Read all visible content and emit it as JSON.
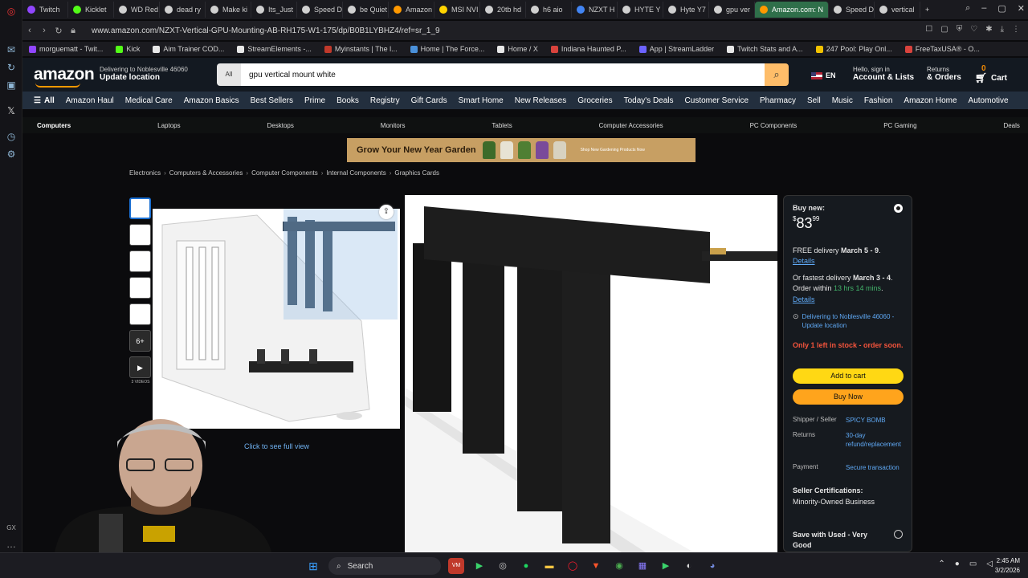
{
  "browser": {
    "tabs": [
      {
        "label": "Twitch",
        "color": "#9146ff"
      },
      {
        "label": "Kicklet",
        "color": "#53fc18"
      },
      {
        "label": "WD Red",
        "color": "#d0d0d0"
      },
      {
        "label": "dead ry",
        "color": "#d0d0d0"
      },
      {
        "label": "Make ki",
        "color": "#d0d0d0"
      },
      {
        "label": "Its_Just",
        "color": "#d0d0d0"
      },
      {
        "label": "Speed D",
        "color": "#d0d0d0"
      },
      {
        "label": "be Quiet",
        "color": "#d0d0d0"
      },
      {
        "label": "Amazon",
        "color": "#ff9900"
      },
      {
        "label": "MSI NVI",
        "color": "#ffd400"
      },
      {
        "label": "20tb hd",
        "color": "#d0d0d0"
      },
      {
        "label": "h6 aio",
        "color": "#d0d0d0"
      },
      {
        "label": "NZXT H",
        "color": "#4285f4"
      },
      {
        "label": "HYTE Y",
        "color": "#d0d0d0"
      },
      {
        "label": "Hyte Y7",
        "color": "#d0d0d0"
      },
      {
        "label": "gpu ver",
        "color": "#d0d0d0"
      },
      {
        "label": "Amazon.com: N",
        "color": "#ff9900",
        "active": true
      },
      {
        "label": "Speed D",
        "color": "#d0d0d0"
      },
      {
        "label": "vertical",
        "color": "#d0d0d0"
      }
    ],
    "new_tab": "+",
    "url": "www.amazon.com/NZXT-Vertical-GPU-Mounting-AB-RH175-W1-175/dp/B0B1LYBHZ4/ref=sr_1_9",
    "bookmarks": [
      {
        "label": "morguematt - Twit...",
        "color": "#9146ff"
      },
      {
        "label": "Kick",
        "color": "#53fc18"
      },
      {
        "label": "Aim Trainer COD...",
        "color": "#e8e8e8"
      },
      {
        "label": "StreamElements -...",
        "color": "#e8e8e8"
      },
      {
        "label": "Myinstants | The l...",
        "color": "#c0392b"
      },
      {
        "label": "Home | The Force...",
        "color": "#4a90d9"
      },
      {
        "label": "Home / X",
        "color": "#e8e8e8"
      },
      {
        "label": "Indiana Haunted P...",
        "color": "#d9433d"
      },
      {
        "label": "App | StreamLadder",
        "color": "#6c63ff"
      },
      {
        "label": "Twitch Stats and A...",
        "color": "#e8e8e8"
      },
      {
        "label": "247 Pool: Play Onl...",
        "color": "#f2c200"
      },
      {
        "label": "FreeTaxUSA® - O...",
        "color": "#d9433d"
      }
    ]
  },
  "amazon": {
    "logo": "amazon",
    "deliver_line1": "Delivering to Noblesville 46060",
    "deliver_line2": "Update location",
    "search_category": "All",
    "search_value": "gpu vertical mount white",
    "lang": "EN",
    "account_line1": "Hello, sign in",
    "account_line2": "Account & Lists",
    "returns_line1": "Returns",
    "returns_line2": "& Orders",
    "cart_count": "0",
    "cart_label": "Cart",
    "nav_all": "All",
    "nav": [
      "Amazon Haul",
      "Medical Care",
      "Amazon Basics",
      "Best Sellers",
      "Prime",
      "Books",
      "Registry",
      "Gift Cards",
      "Smart Home",
      "New Releases",
      "Groceries",
      "Today's Deals",
      "Customer Service",
      "Pharmacy",
      "Sell",
      "Music",
      "Fashion",
      "Amazon Home",
      "Automotive"
    ],
    "subnav": [
      "Computers",
      "Laptops",
      "Desktops",
      "Monitors",
      "Tablets",
      "Computer Accessories",
      "PC Components",
      "PC Gaming",
      "Deals"
    ],
    "banner_text": "Grow Your New Year Garden",
    "banner_shop": "Shop New Gardening Products Now",
    "breadcrumb": [
      "Electronics",
      "Computers & Accessories",
      "Computer Components",
      "Internal Components",
      "Graphics Cards"
    ],
    "thumb_more": "6+",
    "videos_label": "3 VIDEOS",
    "see_full_view": "Click to see full view"
  },
  "buybox": {
    "buy_new": "Buy new:",
    "price_dollar": "$",
    "price_whole": "83",
    "price_cents": "99",
    "free_delivery_prefix": "FREE delivery ",
    "free_delivery_date": "March 5 - 9",
    "free_delivery_suffix": ".",
    "details": "Details",
    "fastest_prefix": "Or fastest delivery ",
    "fastest_date": "March 3 - 4",
    "fastest_suffix": ".",
    "order_within_prefix": "Order within ",
    "order_within_time": "13 hrs 14 mins",
    "order_within_suffix": ".",
    "details2": "Details",
    "location": "Delivering to Noblesville 46060 - Update location",
    "stock": "Only 1 left in stock - order soon.",
    "add_to_cart": "Add to cart",
    "buy_now": "Buy Now",
    "shipper_label": "Shipper / Seller",
    "shipper_value": "SPICY BOMB",
    "returns_label": "Returns",
    "returns_value": "30-day refund/replacement",
    "payment_label": "Payment",
    "payment_value": "Secure transaction",
    "cert_title": "Seller Certifications:",
    "cert_value": "Minority-Owned Business",
    "used": "Save with Used - Very Good"
  },
  "taskbar": {
    "search": "Search",
    "time": "2:45 AM",
    "date": "3/2/2026"
  }
}
